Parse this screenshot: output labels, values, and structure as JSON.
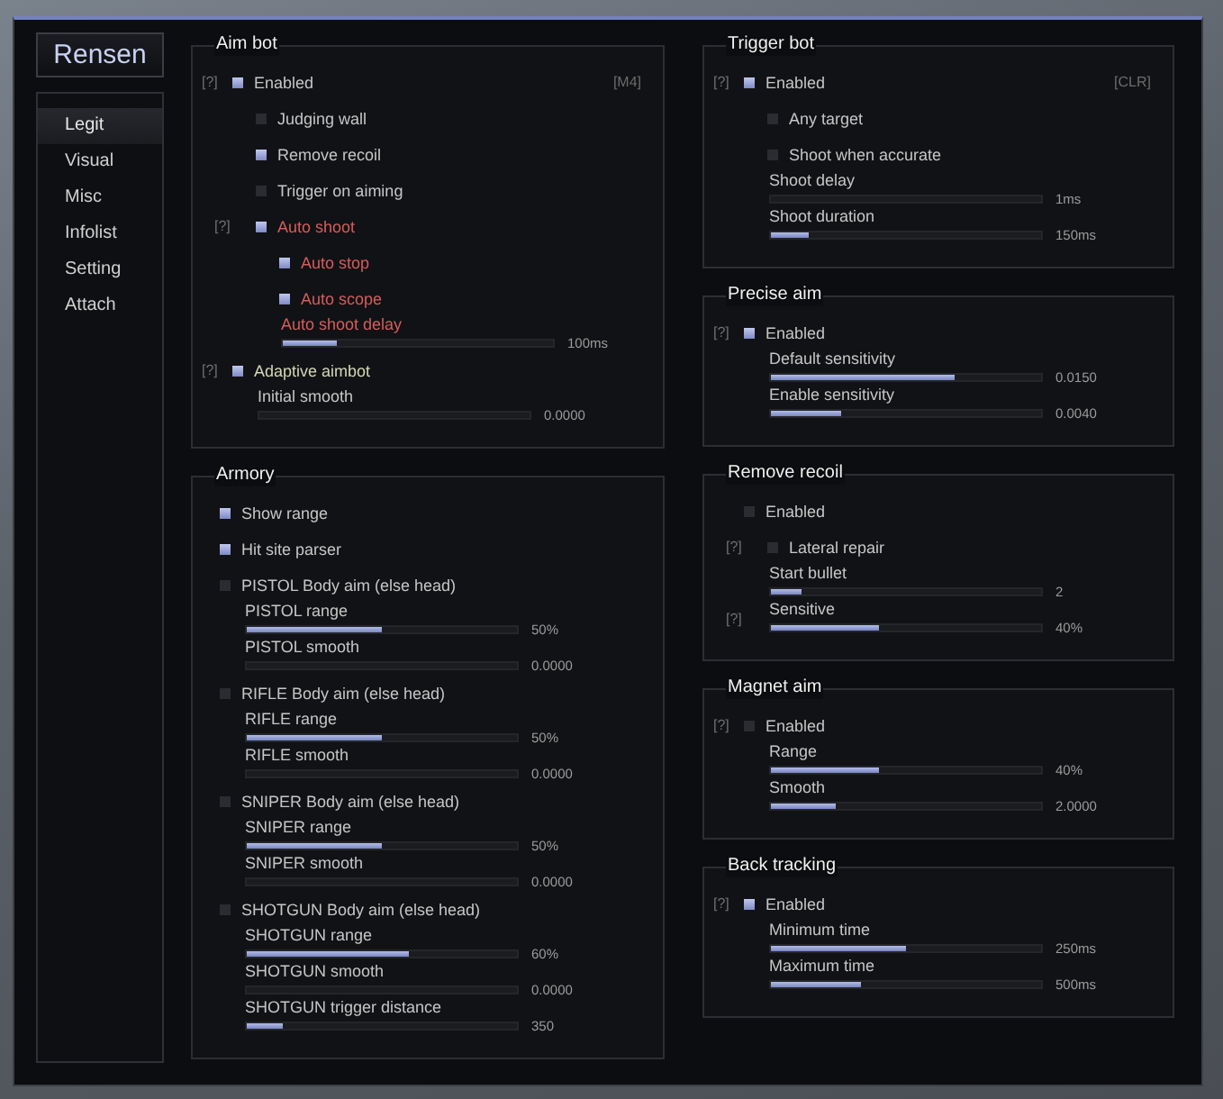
{
  "logo": "Rensen",
  "sidebar": {
    "items": [
      {
        "label": "Legit",
        "selected": true
      },
      {
        "label": "Visual",
        "selected": false
      },
      {
        "label": "Misc",
        "selected": false
      },
      {
        "label": "Infolist",
        "selected": false
      },
      {
        "label": "Setting",
        "selected": false
      },
      {
        "label": "Attach",
        "selected": false
      }
    ]
  },
  "left_column": [
    {
      "title": "Aim bot",
      "rows": [
        {
          "kind": "checkbox",
          "help": "[?]",
          "label": "Enabled",
          "checked": true,
          "hotkey": "[M4]",
          "children": [
            {
              "kind": "checkbox",
              "label": "Judging wall",
              "checked": false
            },
            {
              "kind": "checkbox",
              "label": "Remove recoil",
              "checked": true
            },
            {
              "kind": "checkbox",
              "label": "Trigger on aiming",
              "checked": false
            },
            {
              "kind": "checkbox",
              "help": "[?]",
              "label": "Auto shoot",
              "checked": true,
              "color": "#d65c5c",
              "children": [
                {
                  "kind": "checkbox",
                  "label": "Auto stop",
                  "checked": true,
                  "color": "#d65c5c"
                },
                {
                  "kind": "checkbox",
                  "label": "Auto scope",
                  "checked": true,
                  "color": "#d65c5c"
                },
                {
                  "kind": "slider",
                  "label": "Auto shoot delay",
                  "level": 0.2,
                  "reading": "100ms",
                  "color": "#d65c5c"
                }
              ]
            }
          ]
        },
        {
          "kind": "checkbox",
          "help": "[?]",
          "label": "Adaptive aimbot",
          "checked": true,
          "color": "#d4d6b4",
          "children": [
            {
              "kind": "slider",
              "label": "Initial smooth",
              "level": 0,
              "reading": "0.0000"
            }
          ]
        }
      ]
    },
    {
      "title": "Armory",
      "rows": [
        {
          "kind": "checkbox",
          "label": "Show range",
          "checked": true
        },
        {
          "kind": "checkbox",
          "label": "Hit site parser",
          "checked": true
        },
        {
          "kind": "checkbox",
          "label": "PISTOL Body aim (else head)",
          "checked": false,
          "children": [
            {
              "kind": "slider",
              "label": "PISTOL range",
              "level": 0.5,
              "reading": "50%"
            },
            {
              "kind": "slider",
              "label": "PISTOL smooth",
              "level": 0,
              "reading": "0.0000"
            }
          ]
        },
        {
          "kind": "checkbox",
          "label": "RIFLE Body aim (else head)",
          "checked": false,
          "children": [
            {
              "kind": "slider",
              "label": "RIFLE range",
              "level": 0.5,
              "reading": "50%"
            },
            {
              "kind": "slider",
              "label": "RIFLE smooth",
              "level": 0,
              "reading": "0.0000"
            }
          ]
        },
        {
          "kind": "checkbox",
          "label": "SNIPER Body aim (else head)",
          "checked": false,
          "children": [
            {
              "kind": "slider",
              "label": "SNIPER range",
              "level": 0.5,
              "reading": "50%"
            },
            {
              "kind": "slider",
              "label": "SNIPER smooth",
              "level": 0,
              "reading": "0.0000"
            }
          ]
        },
        {
          "kind": "checkbox",
          "label": "SHOTGUN Body aim (else head)",
          "checked": false,
          "children": [
            {
              "kind": "slider",
              "label": "SHOTGUN range",
              "level": 0.6,
              "reading": "60%"
            },
            {
              "kind": "slider",
              "label": "SHOTGUN smooth",
              "level": 0,
              "reading": "0.0000"
            },
            {
              "kind": "slider",
              "label": "SHOTGUN trigger distance",
              "level": 0.13,
              "reading": "350"
            }
          ]
        }
      ]
    }
  ],
  "right_column": [
    {
      "title": "Trigger bot",
      "rows": [
        {
          "kind": "checkbox",
          "help": "[?]",
          "label": "Enabled",
          "checked": true,
          "hotkey": "[CLR]",
          "children": [
            {
              "kind": "checkbox",
              "label": "Any target",
              "checked": false
            },
            {
              "kind": "checkbox",
              "label": "Shoot when accurate",
              "checked": false
            },
            {
              "kind": "slider",
              "label": "Shoot delay",
              "level": 0,
              "reading": "1ms"
            },
            {
              "kind": "slider",
              "label": "Shoot duration",
              "level": 0.14,
              "reading": "150ms"
            }
          ]
        }
      ]
    },
    {
      "title": "Precise aim",
      "rows": [
        {
          "kind": "checkbox",
          "help": "[?]",
          "label": "Enabled",
          "checked": true,
          "children": [
            {
              "kind": "slider",
              "label": "Default sensitivity",
              "level": 0.68,
              "reading": "0.0150"
            },
            {
              "kind": "slider",
              "label": "Enable sensitivity",
              "level": 0.26,
              "reading": "0.0040"
            }
          ]
        }
      ]
    },
    {
      "title": "Remove recoil",
      "rows": [
        {
          "kind": "checkbox",
          "label": "Enabled",
          "checked": false,
          "children": [
            {
              "kind": "checkbox",
              "help": "[?]",
              "label": "Lateral repair",
              "checked": false
            },
            {
              "kind": "slider",
              "label": "Start bullet",
              "level": 0.11,
              "reading": "2"
            },
            {
              "kind": "slider",
              "help": "[?]",
              "label": "Sensitive",
              "level": 0.4,
              "reading": "40%"
            }
          ]
        }
      ]
    },
    {
      "title": "Magnet aim",
      "rows": [
        {
          "kind": "checkbox",
          "help": "[?]",
          "label": "Enabled",
          "checked": false,
          "children": [
            {
              "kind": "slider",
              "label": "Range",
              "level": 0.4,
              "reading": "40%"
            },
            {
              "kind": "slider",
              "label": "Smooth",
              "level": 0.24,
              "reading": "2.0000"
            }
          ]
        }
      ]
    },
    {
      "title": "Back tracking",
      "rows": [
        {
          "kind": "checkbox",
          "help": "[?]",
          "label": "Enabled",
          "checked": true,
          "children": [
            {
              "kind": "slider",
              "label": "Minimum time",
              "level": 0.5,
              "reading": "250ms"
            },
            {
              "kind": "slider",
              "label": "Maximum time",
              "level": 0.33,
              "reading": "500ms"
            }
          ]
        }
      ]
    }
  ]
}
